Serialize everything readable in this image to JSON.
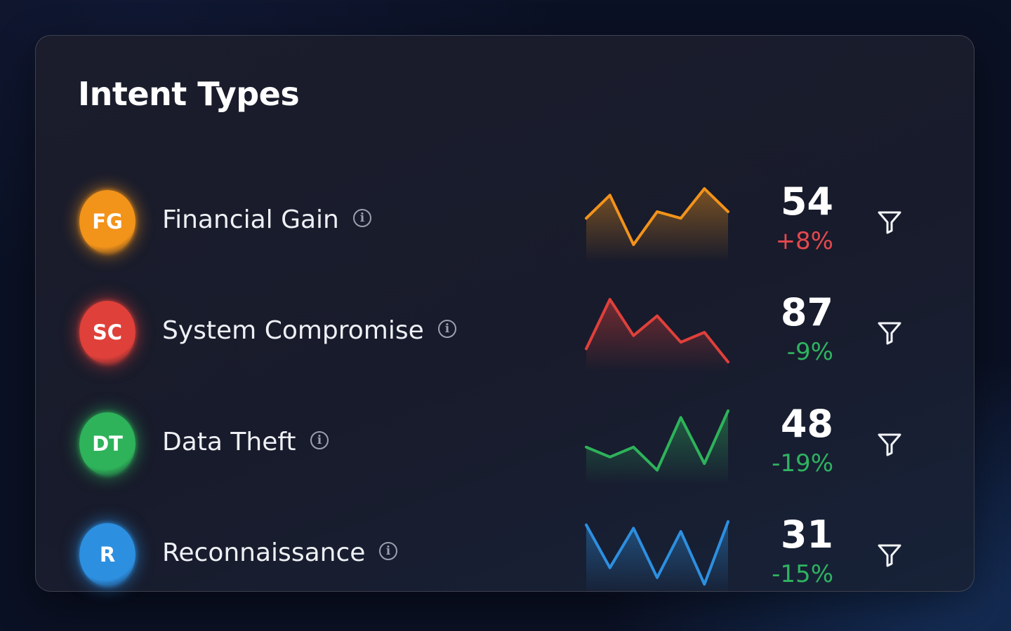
{
  "title": "Intent Types",
  "colors": {
    "up": "#e5484d",
    "down": "#2fb360"
  },
  "intents": [
    {
      "initials": "FG",
      "label": "Financial Gain",
      "value": "54",
      "delta": "+8%",
      "trend": "up",
      "color": "#f2931a",
      "spark": [
        0.55,
        0.9,
        0.15,
        0.65,
        0.55,
        1.0,
        0.65
      ]
    },
    {
      "initials": "SC",
      "label": "System Compromise",
      "value": "87",
      "delta": "-9%",
      "trend": "down",
      "color": "#e0403a",
      "spark": [
        0.25,
        1.0,
        0.45,
        0.75,
        0.35,
        0.5,
        0.05
      ]
    },
    {
      "initials": "DT",
      "label": "Data Theft",
      "value": "48",
      "delta": "-19%",
      "trend": "down",
      "color": "#2eb35a",
      "spark": [
        0.45,
        0.3,
        0.45,
        0.1,
        0.9,
        0.2,
        1.0
      ]
    },
    {
      "initials": "R",
      "label": "Reconnaissance",
      "value": "31",
      "delta": "-15%",
      "trend": "down",
      "color": "#2d8fe0",
      "spark": [
        0.95,
        0.3,
        0.9,
        0.15,
        0.85,
        0.05,
        1.0
      ]
    }
  ]
}
